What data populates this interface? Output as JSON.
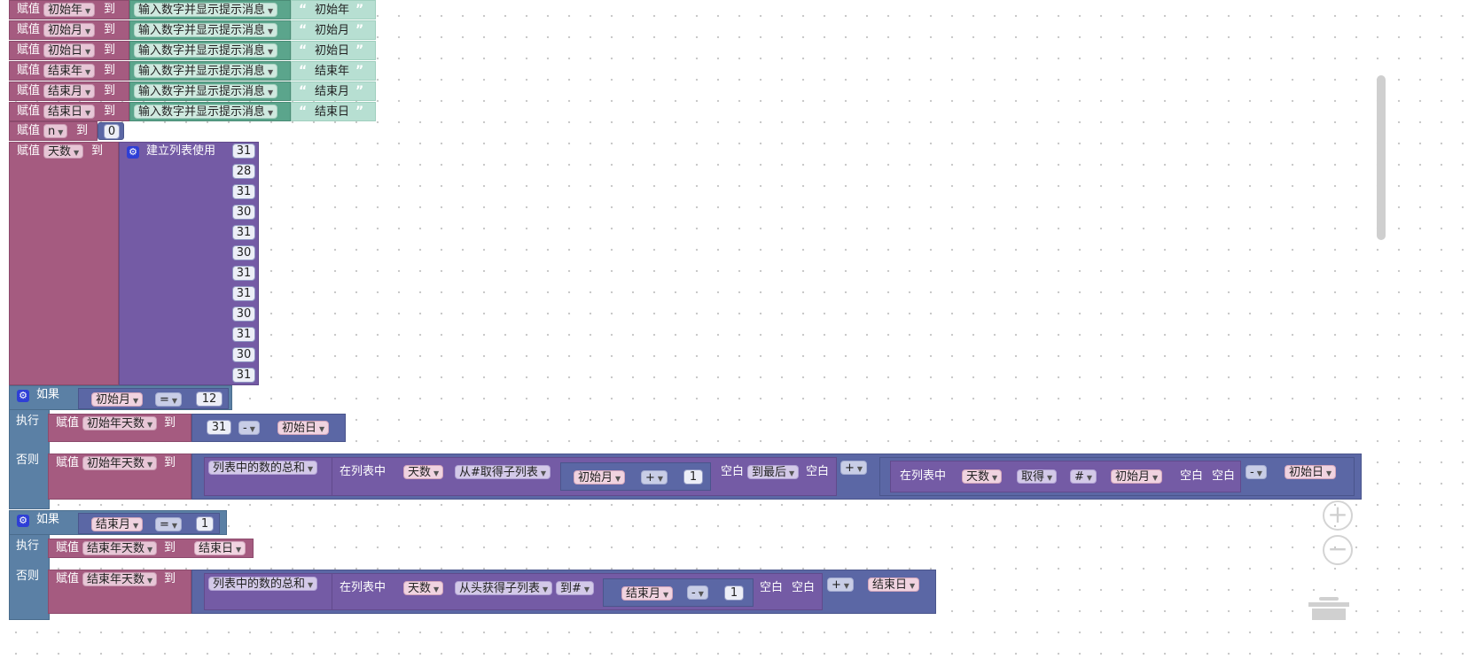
{
  "labels": {
    "assign": "赋值",
    "to": "到",
    "if": "如果",
    "do": "执行",
    "else": "否则",
    "prompt": "输入数字并显示提示消息",
    "create_list": "建立列表使用",
    "sum_of_list": "列表中的数的总和",
    "in_list": "在列表中",
    "from_pos": "从#取得子列表",
    "to_last": "到最后",
    "blank": "空白",
    "get": "取得",
    "from_start": "从头获得子列表",
    "to_pos": "到#",
    "open_quote": "“",
    "close_quote": "”"
  },
  "vars": {
    "start_year": "初始年",
    "start_month": "初始月",
    "start_day": "初始日",
    "end_year": "结束年",
    "end_month": "结束月",
    "end_day": "结束日",
    "n": "n",
    "days": "天数",
    "start_year_days": "初始年天数",
    "end_year_days": "结束年天数"
  },
  "assign_rows": [
    {
      "var": "初始年",
      "prompt": "初始年"
    },
    {
      "var": "初始月",
      "prompt": "初始月"
    },
    {
      "var": "初始日",
      "prompt": "初始日"
    },
    {
      "var": "结束年",
      "prompt": "结束年"
    },
    {
      "var": "结束月",
      "prompt": "结束月"
    },
    {
      "var": "结束日",
      "prompt": "结束日"
    }
  ],
  "n_value": "0",
  "month_days": [
    "31",
    "28",
    "31",
    "30",
    "31",
    "30",
    "31",
    "31",
    "30",
    "31",
    "30",
    "31"
  ],
  "ops": {
    "eq": "=",
    "minus": "-",
    "plus": "+",
    "hash": "#"
  },
  "if1": {
    "value": "12",
    "do_num": "31",
    "plus_one": "1"
  },
  "if2": {
    "value": "1",
    "minus_one": "1"
  },
  "zoom": {
    "in": "+",
    "out": "−"
  }
}
